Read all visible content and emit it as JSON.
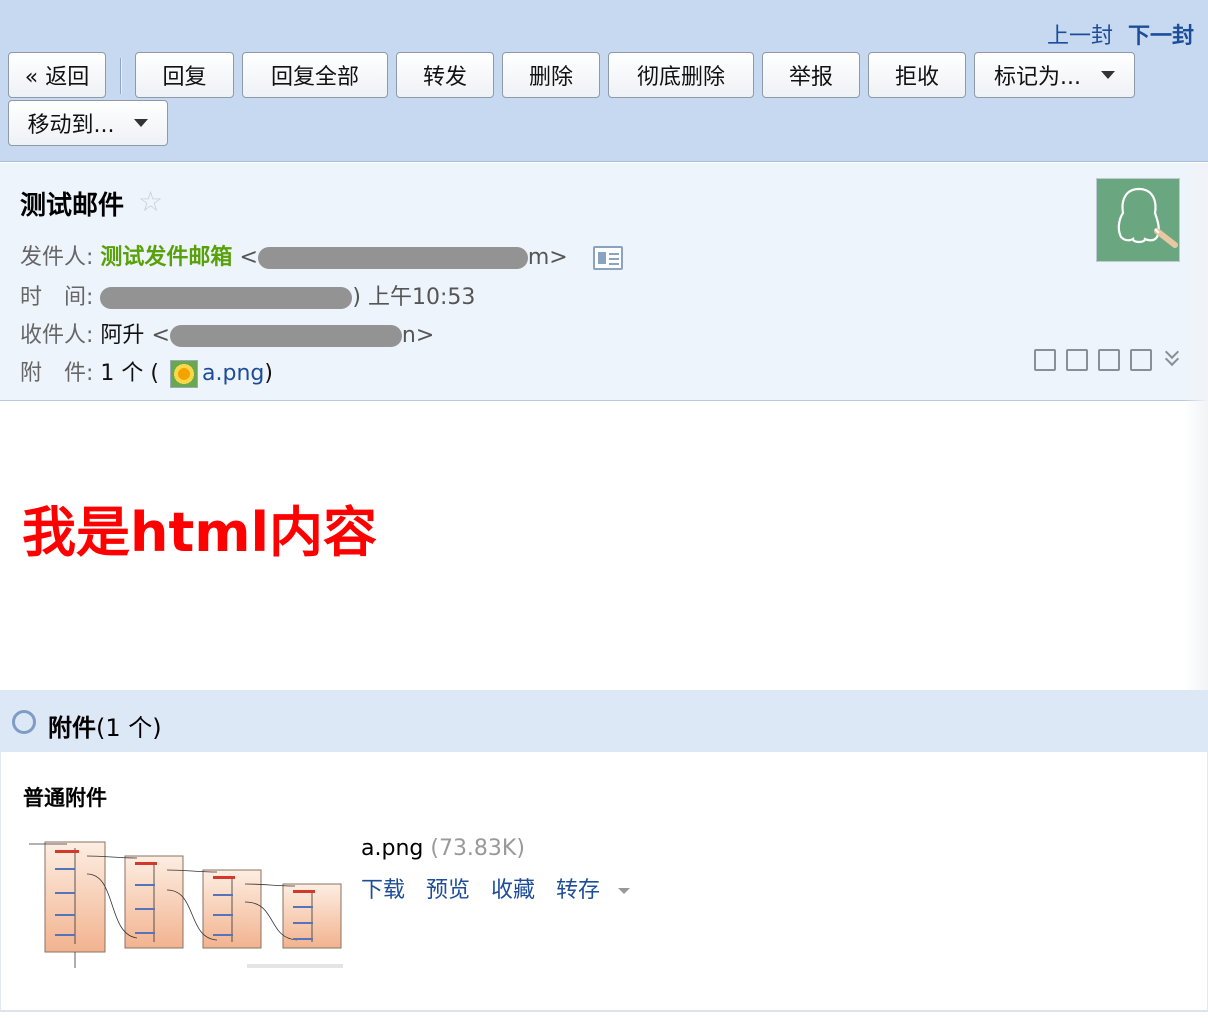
{
  "toolbar": {
    "prev_label": "上一封",
    "next_label": "下一封",
    "buttons": {
      "back": "« 返回",
      "reply": "回复",
      "reply_all": "回复全部",
      "forward": "转发",
      "delete": "删除",
      "perm_delete": "彻底删除",
      "report": "举报",
      "reject": "拒收",
      "mark_as": "标记为...",
      "move_to": "移动到..."
    }
  },
  "header": {
    "subject": "测试邮件",
    "star_glyph": "☆",
    "sender_label": "发件人:",
    "sender_name": "测试发件邮箱",
    "time_label": "时　间:",
    "time_visible": ") 上午10:53",
    "recipient_label": "收件人:",
    "recipient_name": "阿升",
    "attachment_label": "附　件:",
    "attachment_count": "1 个 (",
    "attachment_name": "a.png",
    "attachment_close": ")",
    "open_angle": "<",
    "close_angle_sender": "m>",
    "close_angle_recipient": "n>"
  },
  "body": {
    "content": "我是html内容",
    "content_color": "#ff0000"
  },
  "attachments": {
    "title": "附件",
    "count": "(1 个)",
    "section_label": "普通附件",
    "file_name": "a.png",
    "file_size": "(73.83K)",
    "actions": {
      "download": "下载",
      "preview": "预览",
      "favorite": "收藏",
      "save": "转存"
    }
  },
  "colors": {
    "toolbar_bg": "#c6d9f1",
    "link": "#1d4d99",
    "sender": "#59a10b"
  }
}
